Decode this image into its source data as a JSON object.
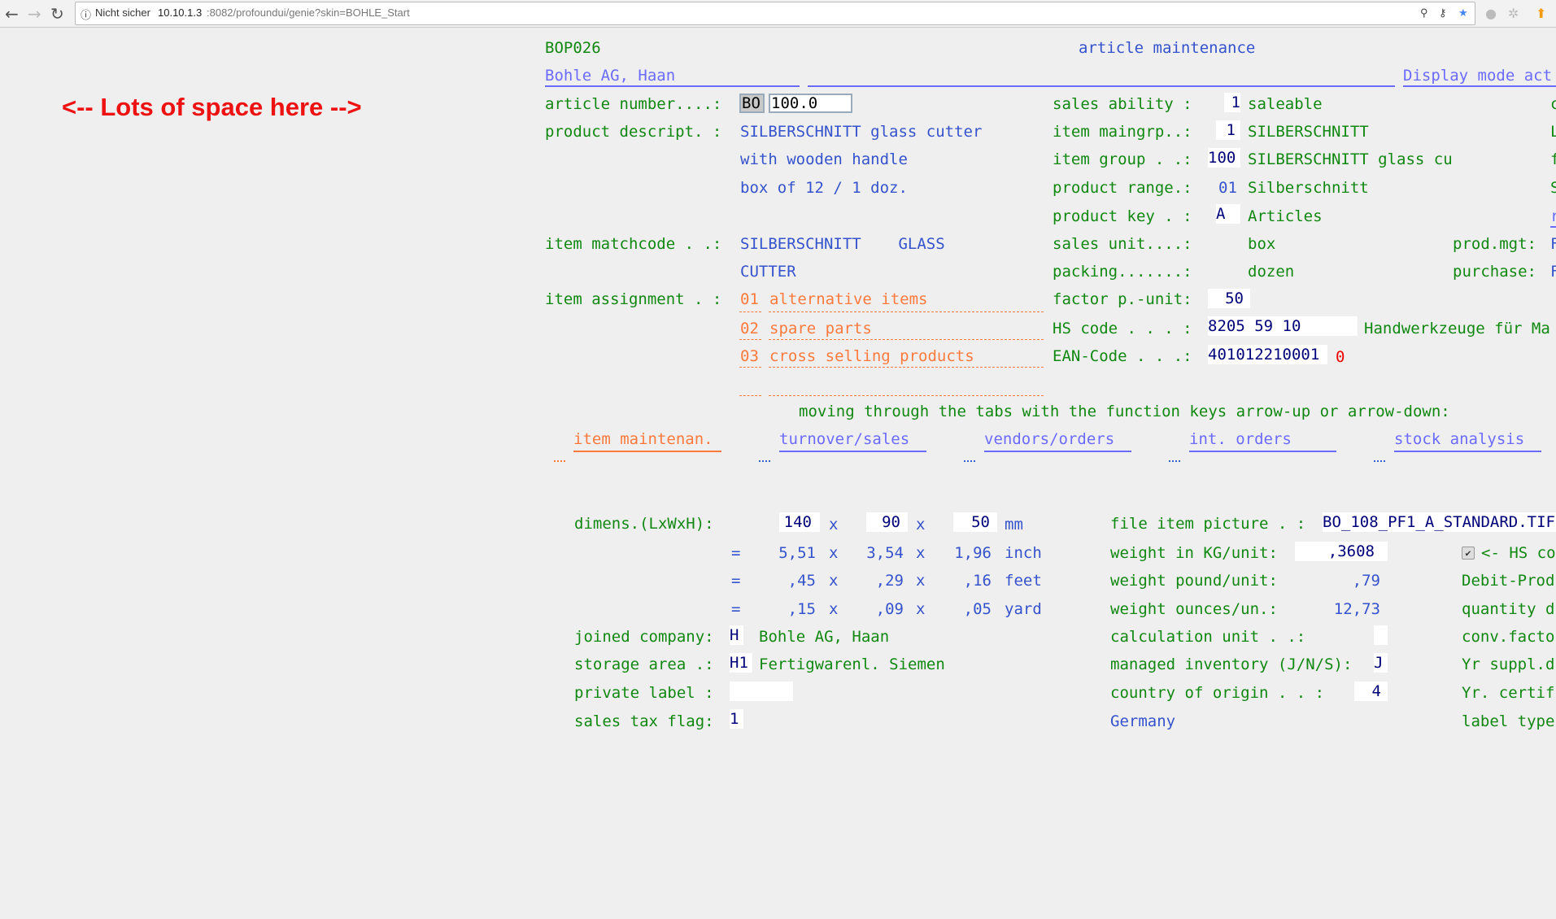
{
  "browser": {
    "security": "Nicht sicher",
    "url_host": "10.10.1.3",
    "url_rest": ":8082/profoundui/genie?skin=BOHLE_Start"
  },
  "note": "<-- Lots of space here -->",
  "header": {
    "program": "BOP026",
    "title": "article maintenance",
    "company": "Bohle AG, Haan",
    "mode": "Display mode act"
  },
  "left": {
    "article_label": "article number....:",
    "article_prefix": "BO",
    "article_number": "100.0",
    "desc_label": "product descript. :",
    "desc": [
      "SILBERSCHNITT glass cutter",
      "with wooden handle",
      "box of 12 / 1 doz."
    ],
    "match_label": "item matchcode . .:",
    "match": [
      "SILBERSCHNITT    GLASS",
      "CUTTER"
    ],
    "assign_label": "item assignment . :",
    "assign": [
      {
        "code": "01",
        "text": "alternative items"
      },
      {
        "code": "02",
        "text": "spare parts"
      },
      {
        "code": "03",
        "text": "cross selling products"
      }
    ]
  },
  "right": {
    "rows": [
      {
        "label": "sales ability :",
        "value": "1",
        "desc": "saleable"
      },
      {
        "label": "item maingrp..:",
        "value": "1",
        "desc": "SILBERSCHNITT"
      },
      {
        "label": "item group . .:",
        "value": "100",
        "desc": "SILBERSCHNITT glass cu"
      },
      {
        "label": "product range.:",
        "value": "01",
        "desc": "Silberschnitt"
      },
      {
        "label": "product key . :",
        "value": "A",
        "desc": "Articles"
      },
      {
        "label": "sales unit....:",
        "desc": "box"
      },
      {
        "label": "packing.......:",
        "desc": "dozen"
      },
      {
        "label": "factor p.-unit:",
        "value": "50"
      },
      {
        "label": "HS code . . . :",
        "value": "8205 59 10",
        "desc": "Handwerkzeuge für Ma"
      },
      {
        "label": "EAN-Code . . .:",
        "value": "401012210001",
        "desc": "0"
      }
    ],
    "prodmgt_label": "prod.mgt:",
    "prodmgt_value": "F",
    "purchase_label": "purchase:",
    "purchase_value": "F",
    "edge": [
      "c",
      "L",
      "f",
      "S",
      "r"
    ]
  },
  "tabs": {
    "hint": "moving through the tabs with the function keys arrow-up or arrow-down:",
    "items": [
      "item maintenan.",
      "turnover/sales",
      "vendors/orders",
      "int. orders",
      "stock analysis"
    ],
    "active": 0
  },
  "dims": {
    "label": "dimens.(LxWxH):",
    "mm": [
      "140",
      "90",
      "50"
    ],
    "mm_unit": "mm",
    "x": "x",
    "eq": "=",
    "inch": [
      "5,51",
      "3,54",
      "1,96"
    ],
    "inch_unit": "inch",
    "feet": [
      ",45",
      ",29",
      ",16"
    ],
    "feet_unit": "feet",
    "yard": [
      ",15",
      ",09",
      ",05"
    ],
    "yard_unit": "yard"
  },
  "lower_left": {
    "joined_label": "joined company:",
    "joined_value": "H",
    "joined_desc": "Bohle AG, Haan",
    "storage_label": "storage area .:",
    "storage_value": "H1",
    "storage_desc": "Fertigwarenl. Siemen",
    "private_label": "private label :",
    "private_value": "",
    "tax_label": "sales tax flag:",
    "tax_value": "1"
  },
  "lower_mid": {
    "picture_label": "file item picture . :",
    "picture_value": "BO_108_PF1_A_STANDARD.TIF",
    "kg_label": "weight in KG/unit:",
    "kg_value": ",3608",
    "pound_label": "weight pound/unit:",
    "pound_value": ",79",
    "ounce_label": "weight ounces/un.:",
    "ounce_value": "12,73",
    "calc_label": "calculation unit . .:",
    "calc_value": "",
    "inv_label": "managed inventory (J/N/S):",
    "inv_value": "J",
    "origin_label": "country of origin . . :",
    "origin_value": "4",
    "origin_name": "Germany"
  },
  "lower_right": {
    "hs_check": true,
    "hs_text": "<- HS co",
    "rows": [
      "Debit-Prod",
      "quantity d",
      "conv.facto",
      "Yr suppl.d",
      "Yr. certif",
      "label type"
    ]
  }
}
